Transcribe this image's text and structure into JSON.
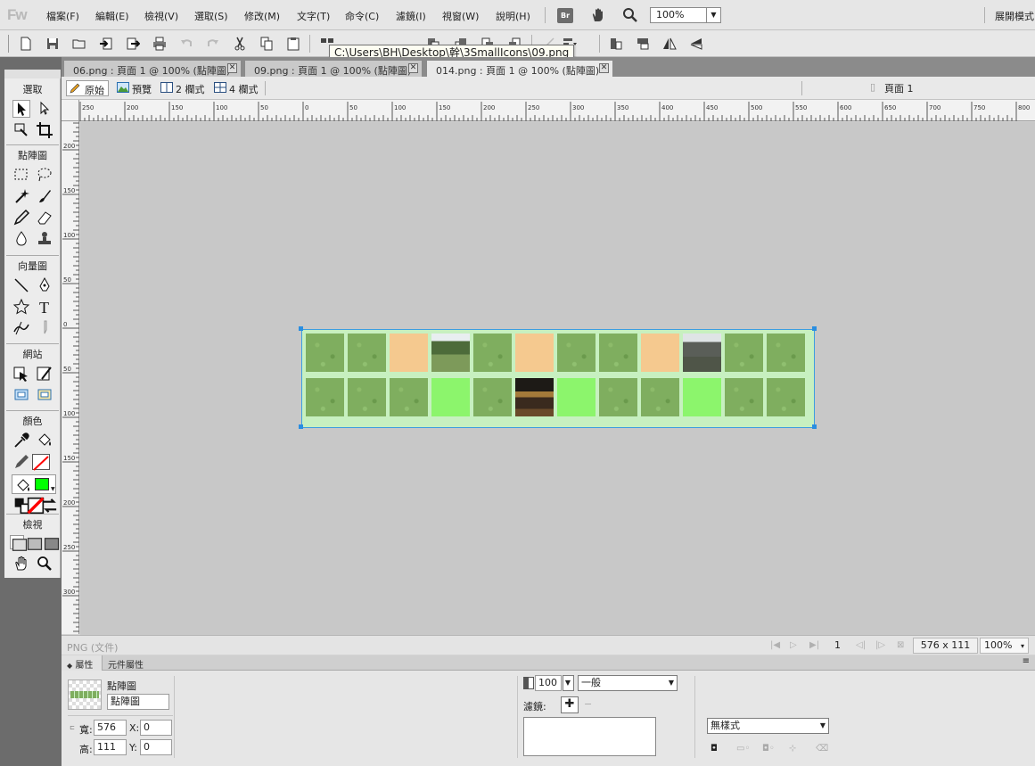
{
  "app": {
    "logo": "Fw",
    "menus": [
      "檔案(F)",
      "編輯(E)",
      "檢視(V)",
      "選取(S)",
      "修改(M)",
      "文字(T)",
      "命令(C)",
      "濾鏡(I)",
      "視窗(W)",
      "說明(H)"
    ],
    "bridge_label": "Br",
    "zoom_value": "100%",
    "expand_mode": "展開模式"
  },
  "tooltip": "C:\\Users\\BH\\Desktop\\幹\\3SmallIcons\\09.png",
  "tools": {
    "sections": [
      "選取",
      "點陣圖",
      "向量圖",
      "網站",
      "顏色",
      "檢視"
    ],
    "fill_color": "#00ff00",
    "stroke_color": "#ff0000"
  },
  "doc_tabs": [
    {
      "label": "06.png : 頁面 1 @ 100% (點陣圖)",
      "active": false
    },
    {
      "label": "09.png : 頁面 1 @ 100% (點陣圖)",
      "active": false
    },
    {
      "label": "014.png : 頁面 1 @ 100% (點陣圖)",
      "active": true
    }
  ],
  "view_bar": {
    "original": "原始",
    "preview": "預覽",
    "two_up": "2 欄式",
    "four_up": "4 欄式",
    "page": "頁面 1"
  },
  "rulers": {
    "top": [
      "250",
      "200",
      "150",
      "100",
      "50",
      "0",
      "50",
      "100",
      "150",
      "200",
      "250",
      "300",
      "350",
      "400",
      "450",
      "500",
      "550",
      "600",
      "650",
      "700",
      "750",
      "800"
    ],
    "left": [
      "200",
      "150",
      "100",
      "50",
      "0",
      "50",
      "100",
      "150",
      "200",
      "250",
      "300"
    ]
  },
  "document": {
    "grid": [
      [
        "grass",
        "grass",
        "sand",
        "photo-trees",
        "grass",
        "sand",
        "grass",
        "grass",
        "sand",
        "photo-ruins",
        "grass",
        "grass"
      ],
      [
        "grass",
        "grass",
        "grass",
        "bright",
        "grass",
        "photo-night",
        "bright",
        "grass",
        "grass",
        "bright",
        "grass",
        "grass"
      ]
    ],
    "colors": {
      "grass": "#7fae5f",
      "sand": "#f5c98f",
      "bright": "#8cf56c",
      "border": "#c7f0c0"
    }
  },
  "status": {
    "doc_type": "PNG (文件)",
    "page_number": "1",
    "size": "576 x 111",
    "zoom": "100%"
  },
  "properties": {
    "tab_props": "屬性",
    "tab_symbol": "元件屬性",
    "object_type": "點陣圖",
    "object_name": "點陣圖",
    "width_label": "寬:",
    "height_label": "高:",
    "width": "576",
    "height": "111",
    "x_label": "X:",
    "y_label": "Y:",
    "x": "0",
    "y": "0",
    "opacity": "100",
    "blend_mode": "一般",
    "filters_label": "濾鏡:",
    "style": "無樣式"
  }
}
